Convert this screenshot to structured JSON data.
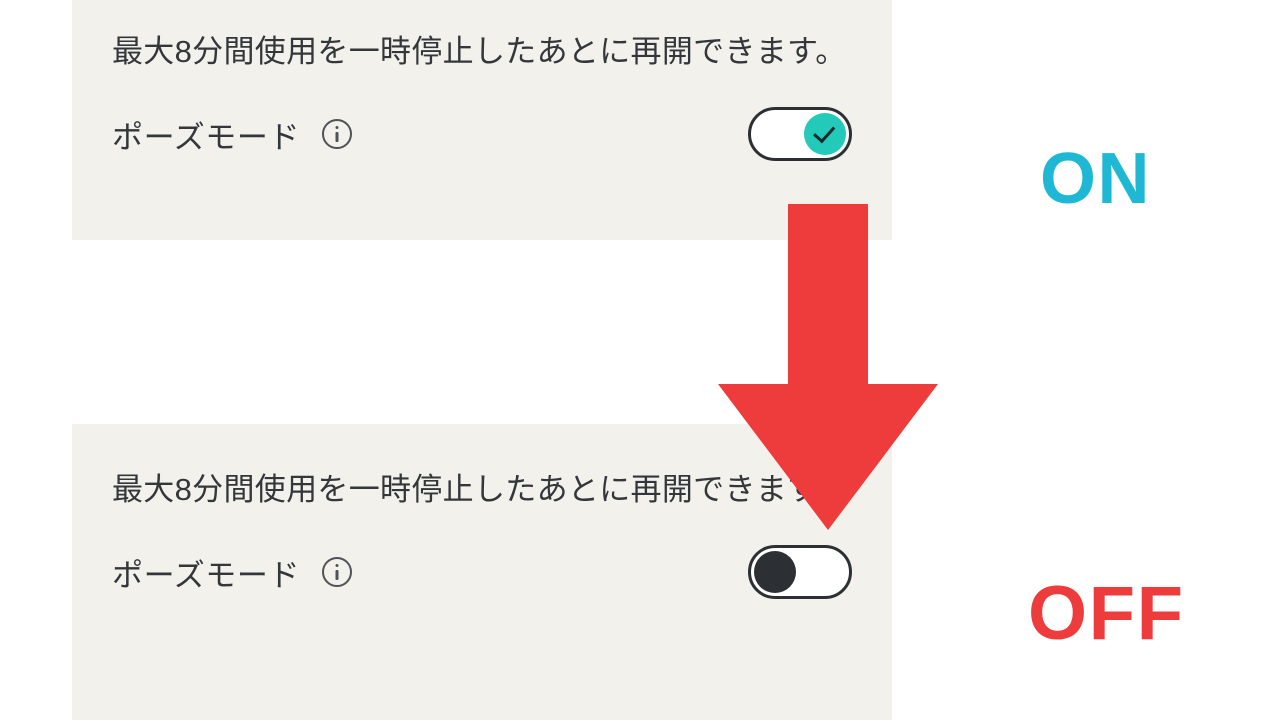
{
  "panels": {
    "top": {
      "description": "最大8分間使用を一時停止したあとに再開できます。",
      "label": "ポーズモード",
      "toggle_state": "on"
    },
    "bottom": {
      "description": "最大8分間使用を一時停止したあとに再開できます。",
      "label": "ポーズモード",
      "toggle_state": "off"
    }
  },
  "annotations": {
    "on": "ON",
    "off": "OFF"
  },
  "colors": {
    "panel_bg": "#f2f1ec",
    "text": "#33373b",
    "toggle_on": "#23c9b9",
    "toggle_off": "#2c2f33",
    "annotation_on": "#1eb8d4",
    "annotation_off_arrow": "#ee3b3b"
  }
}
